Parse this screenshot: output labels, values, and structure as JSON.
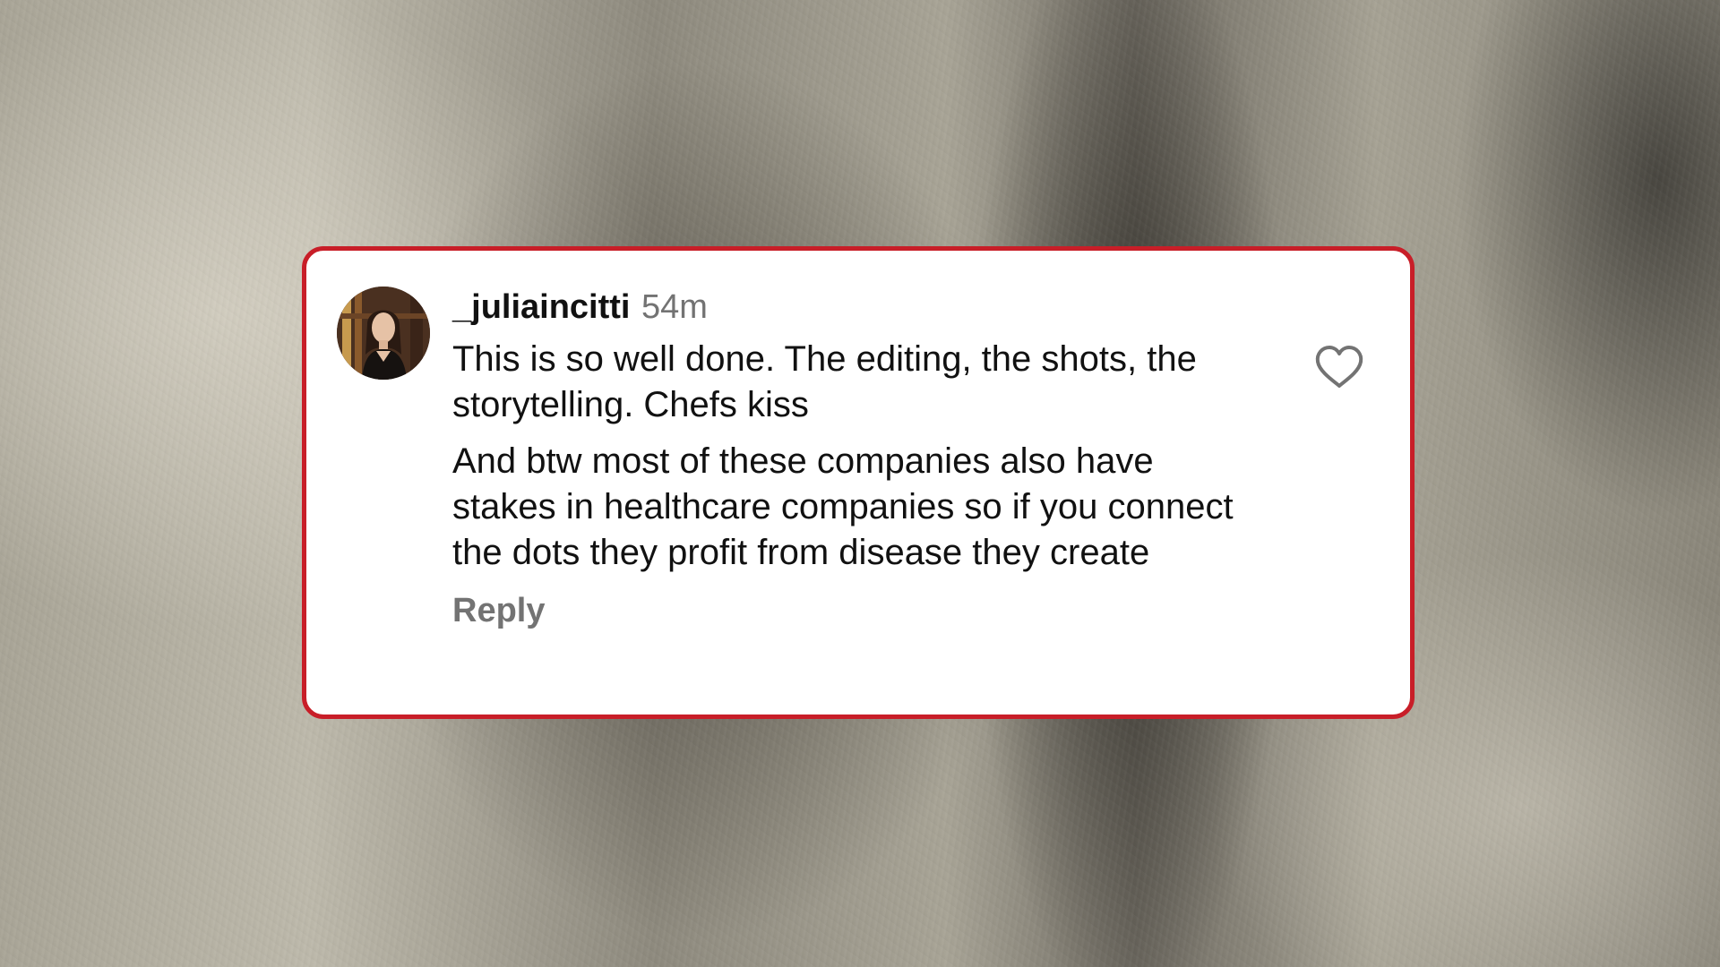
{
  "comment": {
    "username": "_juliaincitti",
    "timestamp": "54m",
    "paragraph_1": "This is so well done. The editing, the shots, the storytelling. Chefs kiss",
    "paragraph_2": "And btw most of these companies also have stakes in healthcare companies so if you connect the dots they profit from disease they create",
    "reply_label": "Reply",
    "like_icon": "heart-outline-icon",
    "avatar": "profile-photo"
  },
  "colors": {
    "card_border": "#c81e28",
    "card_background": "#ffffff",
    "text_primary": "#111111",
    "text_secondary": "#737373"
  }
}
